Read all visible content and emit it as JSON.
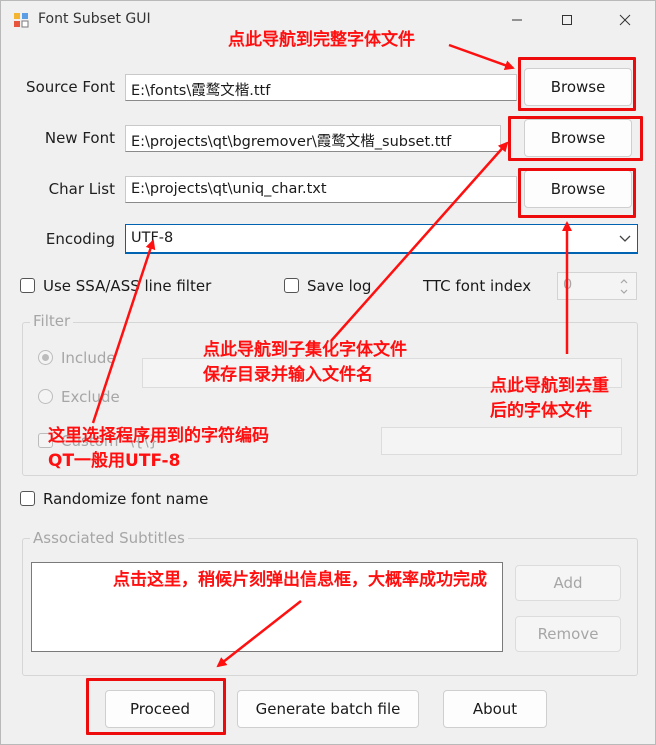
{
  "window": {
    "title": "Font Subset GUI"
  },
  "fields": {
    "source_font": {
      "label": "Source Font",
      "value": "E:\\fonts\\霞鹜文楷.ttf",
      "button": "Browse"
    },
    "new_font": {
      "label": "New Font",
      "value": "E:\\projects\\qt\\bgremover\\霞鹜文楷_subset.ttf",
      "button": "Browse"
    },
    "char_list": {
      "label": "Char List",
      "value": "E:\\projects\\qt\\uniq_char.txt",
      "button": "Browse"
    },
    "encoding": {
      "label": "Encoding",
      "value": "UTF-8"
    }
  },
  "options": {
    "ssa_filter": "Use SSA/ASS line filter",
    "save_log": "Save log",
    "ttc_label": "TTC font index",
    "ttc_value": "0"
  },
  "filter": {
    "title": "Filter",
    "include": "Include",
    "exclude": "Exclude",
    "custom": "Custom",
    "custom_value": "\\{\\}"
  },
  "randomize": "Randomize font name",
  "subtitles": {
    "title": "Associated Subtitles",
    "add": "Add",
    "remove": "Remove"
  },
  "bottom": {
    "proceed": "Proceed",
    "batch": "Generate batch file",
    "about": "About"
  },
  "annotations": {
    "source": "点此导航到完整字体文件",
    "new_line1": "点此导航到子集化字体文件",
    "new_line2": "保存目录并输入文件名",
    "char_line1": "点此导航到去重",
    "char_line2": "后的字体文件",
    "enc_line1": "这里选择程序用到的字符编码",
    "enc_line2": "QT一般用UTF-8",
    "proceed": "点击这里，稍候片刻弹出信息框，大概率成功完成"
  },
  "colors": {
    "annotation_red": "#ff0f0f",
    "focus_blue": "#0063b1"
  }
}
